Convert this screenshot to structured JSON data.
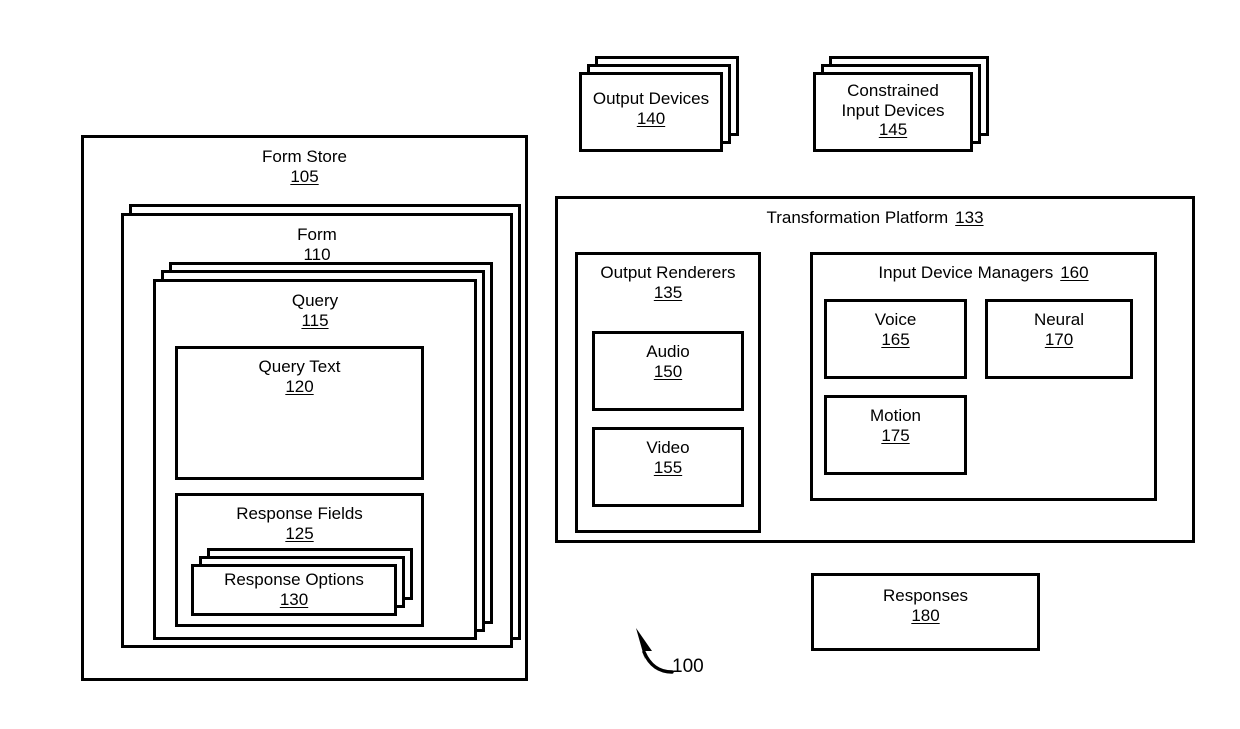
{
  "figure": {
    "reference_numeral": "100",
    "arrow_icon": "curved-arrow-up-left-icon"
  },
  "form_store": {
    "label": "Form Store",
    "number": "105",
    "form": {
      "label": "Form",
      "number": "110",
      "query": {
        "label": "Query",
        "number": "115",
        "query_text": {
          "label": "Query Text",
          "number": "120"
        },
        "response_fields": {
          "label": "Response Fields",
          "number": "125",
          "response_options": {
            "label": "Response Options",
            "number": "130"
          }
        }
      }
    }
  },
  "devices": {
    "output_devices": {
      "label": "Output Devices",
      "number": "140"
    },
    "constrained_input_devices": {
      "label": "Constrained\nInput Devices",
      "number": "145"
    }
  },
  "transformation_platform": {
    "label": "Transformation Platform",
    "number": "133",
    "output_renderers": {
      "label": "Output Renderers",
      "number": "135",
      "items": [
        {
          "label": "Audio",
          "number": "150"
        },
        {
          "label": "Video",
          "number": "155"
        }
      ]
    },
    "input_device_managers": {
      "label": "Input Device Managers",
      "number": "160",
      "items": [
        {
          "label": "Voice",
          "number": "165"
        },
        {
          "label": "Neural",
          "number": "170"
        },
        {
          "label": "Motion",
          "number": "175"
        }
      ]
    }
  },
  "responses": {
    "label": "Responses",
    "number": "180"
  }
}
